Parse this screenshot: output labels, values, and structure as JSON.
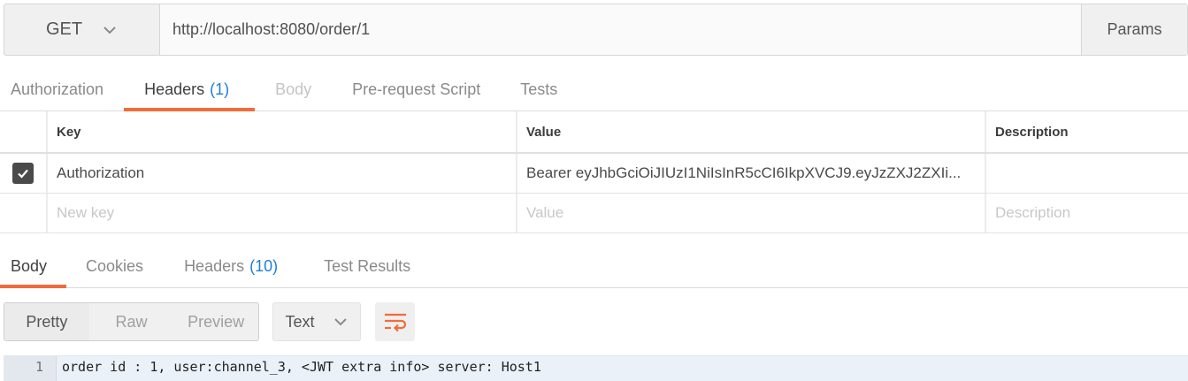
{
  "request": {
    "method": "GET",
    "url": "http://localhost:8080/order/1",
    "params_label": "Params"
  },
  "request_tabs": [
    {
      "label": "Authorization",
      "count": ""
    },
    {
      "label": "Headers",
      "count": "(1)"
    },
    {
      "label": "Body",
      "count": ""
    },
    {
      "label": "Pre-request Script",
      "count": ""
    },
    {
      "label": "Tests",
      "count": ""
    }
  ],
  "headers_table": {
    "columns": [
      "Key",
      "Value",
      "Description"
    ],
    "rows": [
      {
        "checked": true,
        "key": "Authorization",
        "value": "Bearer eyJhbGciOiJIUzI1NiIsInR5cCI6IkpXVCJ9.eyJzZXJ2ZXIi...",
        "description": ""
      }
    ],
    "placeholder": {
      "key": "New key",
      "value": "Value",
      "description": "Description"
    }
  },
  "response_tabs": [
    {
      "label": "Body",
      "count": ""
    },
    {
      "label": "Cookies",
      "count": ""
    },
    {
      "label": "Headers",
      "count": "(10)"
    },
    {
      "label": "Test Results",
      "count": ""
    }
  ],
  "view_modes": [
    "Pretty",
    "Raw",
    "Preview"
  ],
  "format": "Text",
  "icons": {
    "method_dropdown": "chevron-down-icon",
    "checkbox": "check-icon",
    "format_dropdown": "chevron-down-icon",
    "wrap": "wrap-lines-icon"
  },
  "colors": {
    "accent": "#f26b3a",
    "count": "#1f7fd6"
  },
  "response_body": {
    "line_number": "1",
    "text": "order id : 1, user:channel_3, <JWT extra info> server: Host1"
  }
}
